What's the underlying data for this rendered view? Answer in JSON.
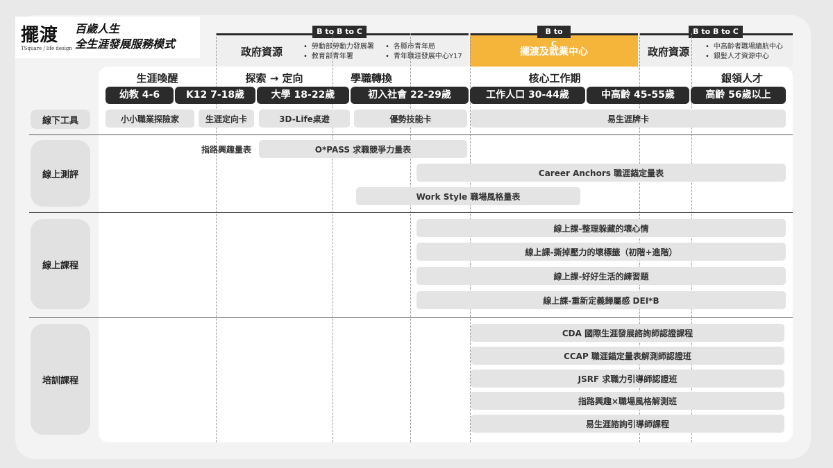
{
  "logo": {
    "mark": "擺渡",
    "sub": "TSquare / life design",
    "title_line1": "百歲人生",
    "title_line2": "全生涯發展服務模式"
  },
  "header": {
    "badges": [
      "B to B to C",
      "B to C",
      "B to B to C"
    ],
    "gov_left": {
      "title": "政府資源",
      "bullets_a": [
        "勞動部勞動力發展署",
        "教育部青年署"
      ],
      "bullets_b": [
        "各縣市青年局",
        "青年職涯發展中心Y17"
      ]
    },
    "center": {
      "title": "擺渡及就業中心"
    },
    "gov_right": {
      "title": "政府資源",
      "bullets": [
        "中高齡者職場續航中心",
        "銀髮人才資源中心"
      ]
    }
  },
  "stages": [
    "生涯喚醒",
    "探索 → 定向",
    "學職轉換",
    "核心工作期",
    "銀領人才"
  ],
  "ages": [
    "幼教 4-6",
    "K12 7-18歲",
    "大學 18-22歲",
    "初入社會 22-29歲",
    "工作人口 30-44歲",
    "中高齡 45-55歲",
    "高齡 56歲以上"
  ],
  "rows": {
    "offline": {
      "label": "線下工具",
      "items": [
        "小小職業探險家",
        "生涯定向卡",
        "3D-Life桌遊",
        "優勢技能卡",
        "易生涯牌卡"
      ]
    },
    "assessment": {
      "label": "線上測評",
      "items": [
        "指路興趣量表",
        "O*PASS 求職競爭力量表",
        "Career Anchors 職涯錨定量表",
        "Work Style 職場風格量表"
      ]
    },
    "courses": {
      "label": "線上課程",
      "items": [
        "線上課-整理躲藏的壞心情",
        "線上課-撕掉壓力的壞標籤（初階+進階）",
        "線上課-好好生活的練習題",
        "線上課-重新定義歸屬感 DEI*B"
      ]
    },
    "training": {
      "label": "培訓課程",
      "items": [
        "CDA 國際生涯發展諮詢師認證課程",
        "CCAP 職涯錨定量表解測師認證班",
        "JSRF 求職力引導師認證班",
        "指路興趣×職場風格解測班",
        "易生涯諮詢引導師課程"
      ]
    }
  },
  "colors": {
    "dark": "#2b2b2b",
    "orange": "#f5b43a",
    "bar": "#e4e4e4",
    "category": "#e1e1e1"
  }
}
